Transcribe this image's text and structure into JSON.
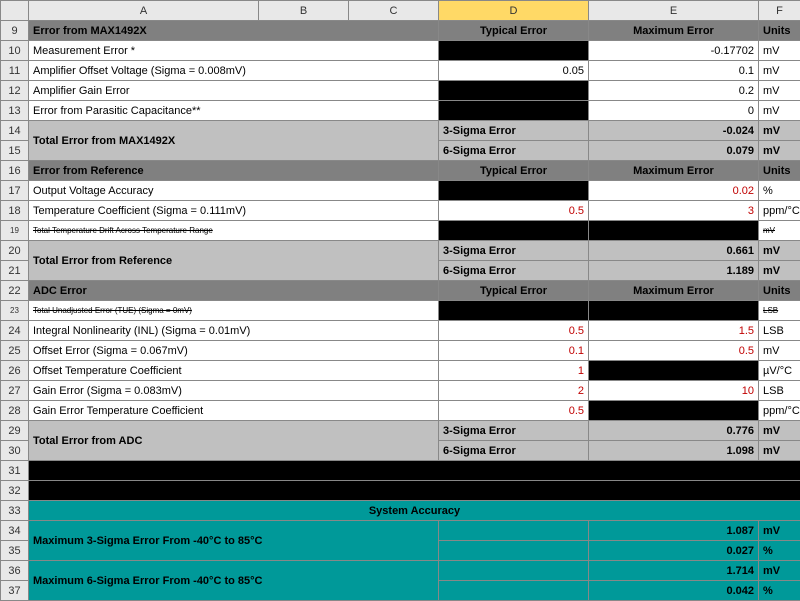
{
  "columns": {
    "A": "A",
    "B": "B",
    "C": "C",
    "D": "D",
    "E": "E",
    "F": "F"
  },
  "rows": {
    "r9": {
      "n": "9",
      "a": "Error from MAX1492X",
      "d": "Typical Error",
      "e": "Maximum Error",
      "f": "Units"
    },
    "r10": {
      "n": "10",
      "a": "Measurement Error *",
      "e": "-0.17702",
      "f": "mV"
    },
    "r11": {
      "n": "11",
      "a": "Amplifier Offset Voltage (Sigma = 0.008mV)",
      "d": "0.05",
      "e": "0.1",
      "f": "mV"
    },
    "r12": {
      "n": "12",
      "a": "Amplifier Gain Error",
      "e": "0.2",
      "f": "mV"
    },
    "r13": {
      "n": "13",
      "a": "Error from Parasitic Capacitance**",
      "e": "0",
      "f": "mV"
    },
    "r14": {
      "n": "14",
      "a": "Total Error from MAX1492X",
      "d": "3-Sigma Error",
      "e": "-0.024",
      "f": "mV"
    },
    "r15": {
      "n": "15",
      "d": "6-Sigma Error",
      "e": "0.079",
      "f": "mV"
    },
    "r16": {
      "n": "16",
      "a": "Error from Reference",
      "d": "Typical Error",
      "e": "Maximum Error",
      "f": "Units"
    },
    "r17": {
      "n": "17",
      "a": "Output Voltage Accuracy",
      "e": "0.02",
      "f": "%"
    },
    "r18": {
      "n": "18",
      "a": "Temperature Coefficient (Sigma = 0.111mV)",
      "d": "0.5",
      "e": "3",
      "f": "ppm/°C"
    },
    "r19": {
      "n": "19",
      "a": "Total Temperature Drift Across Temperature Range",
      "f": "mV"
    },
    "r20": {
      "n": "20",
      "a": "Total Error from Reference",
      "d": "3-Sigma Error",
      "e": "0.661",
      "f": "mV"
    },
    "r21": {
      "n": "21",
      "d": "6-Sigma Error",
      "e": "1.189",
      "f": "mV"
    },
    "r22": {
      "n": "22",
      "a": "ADC Error",
      "d": "Typical Error",
      "e": "Maximum Error",
      "f": "Units"
    },
    "r23": {
      "n": "23",
      "a": "Total Unadjusted Error (TUE) (Sigma = 0mV)",
      "f": "LSB"
    },
    "r24": {
      "n": "24",
      "a": "Integral Nonlinearity (INL) (Sigma = 0.01mV)",
      "d": "0.5",
      "e": "1.5",
      "f": "LSB"
    },
    "r25": {
      "n": "25",
      "a": "Offset Error (Sigma = 0.067mV)",
      "d": "0.1",
      "e": "0.5",
      "f": "mV"
    },
    "r26": {
      "n": "26",
      "a": "Offset Temperature Coefficient",
      "d": "1",
      "f": "µV/°C"
    },
    "r27": {
      "n": "27",
      "a": "Gain Error (Sigma = 0.083mV)",
      "d": "2",
      "e": "10",
      "f": "LSB"
    },
    "r28": {
      "n": "28",
      "a": "Gain Error Temperature Coefficient",
      "d": "0.5",
      "f": "ppm/°C"
    },
    "r29": {
      "n": "29",
      "a": "Total Error from ADC",
      "d": "3-Sigma Error",
      "e": "0.776",
      "f": "mV"
    },
    "r30": {
      "n": "30",
      "d": "6-Sigma Error",
      "e": "1.098",
      "f": "mV"
    },
    "r31": {
      "n": "31"
    },
    "r32": {
      "n": "32"
    },
    "r33": {
      "n": "33",
      "a": "System Accuracy"
    },
    "r34": {
      "n": "34",
      "a": "Maximum 3-Sigma Error From -40°C to 85°C",
      "e": "1.087",
      "f": "mV"
    },
    "r35": {
      "n": "35",
      "e": "0.027",
      "f": "%"
    },
    "r36": {
      "n": "36",
      "a": "Maximum 6-Sigma Error From -40°C to 85°C",
      "e": "1.714",
      "f": "mV"
    },
    "r37": {
      "n": "37",
      "e": "0.042",
      "f": "%"
    }
  }
}
